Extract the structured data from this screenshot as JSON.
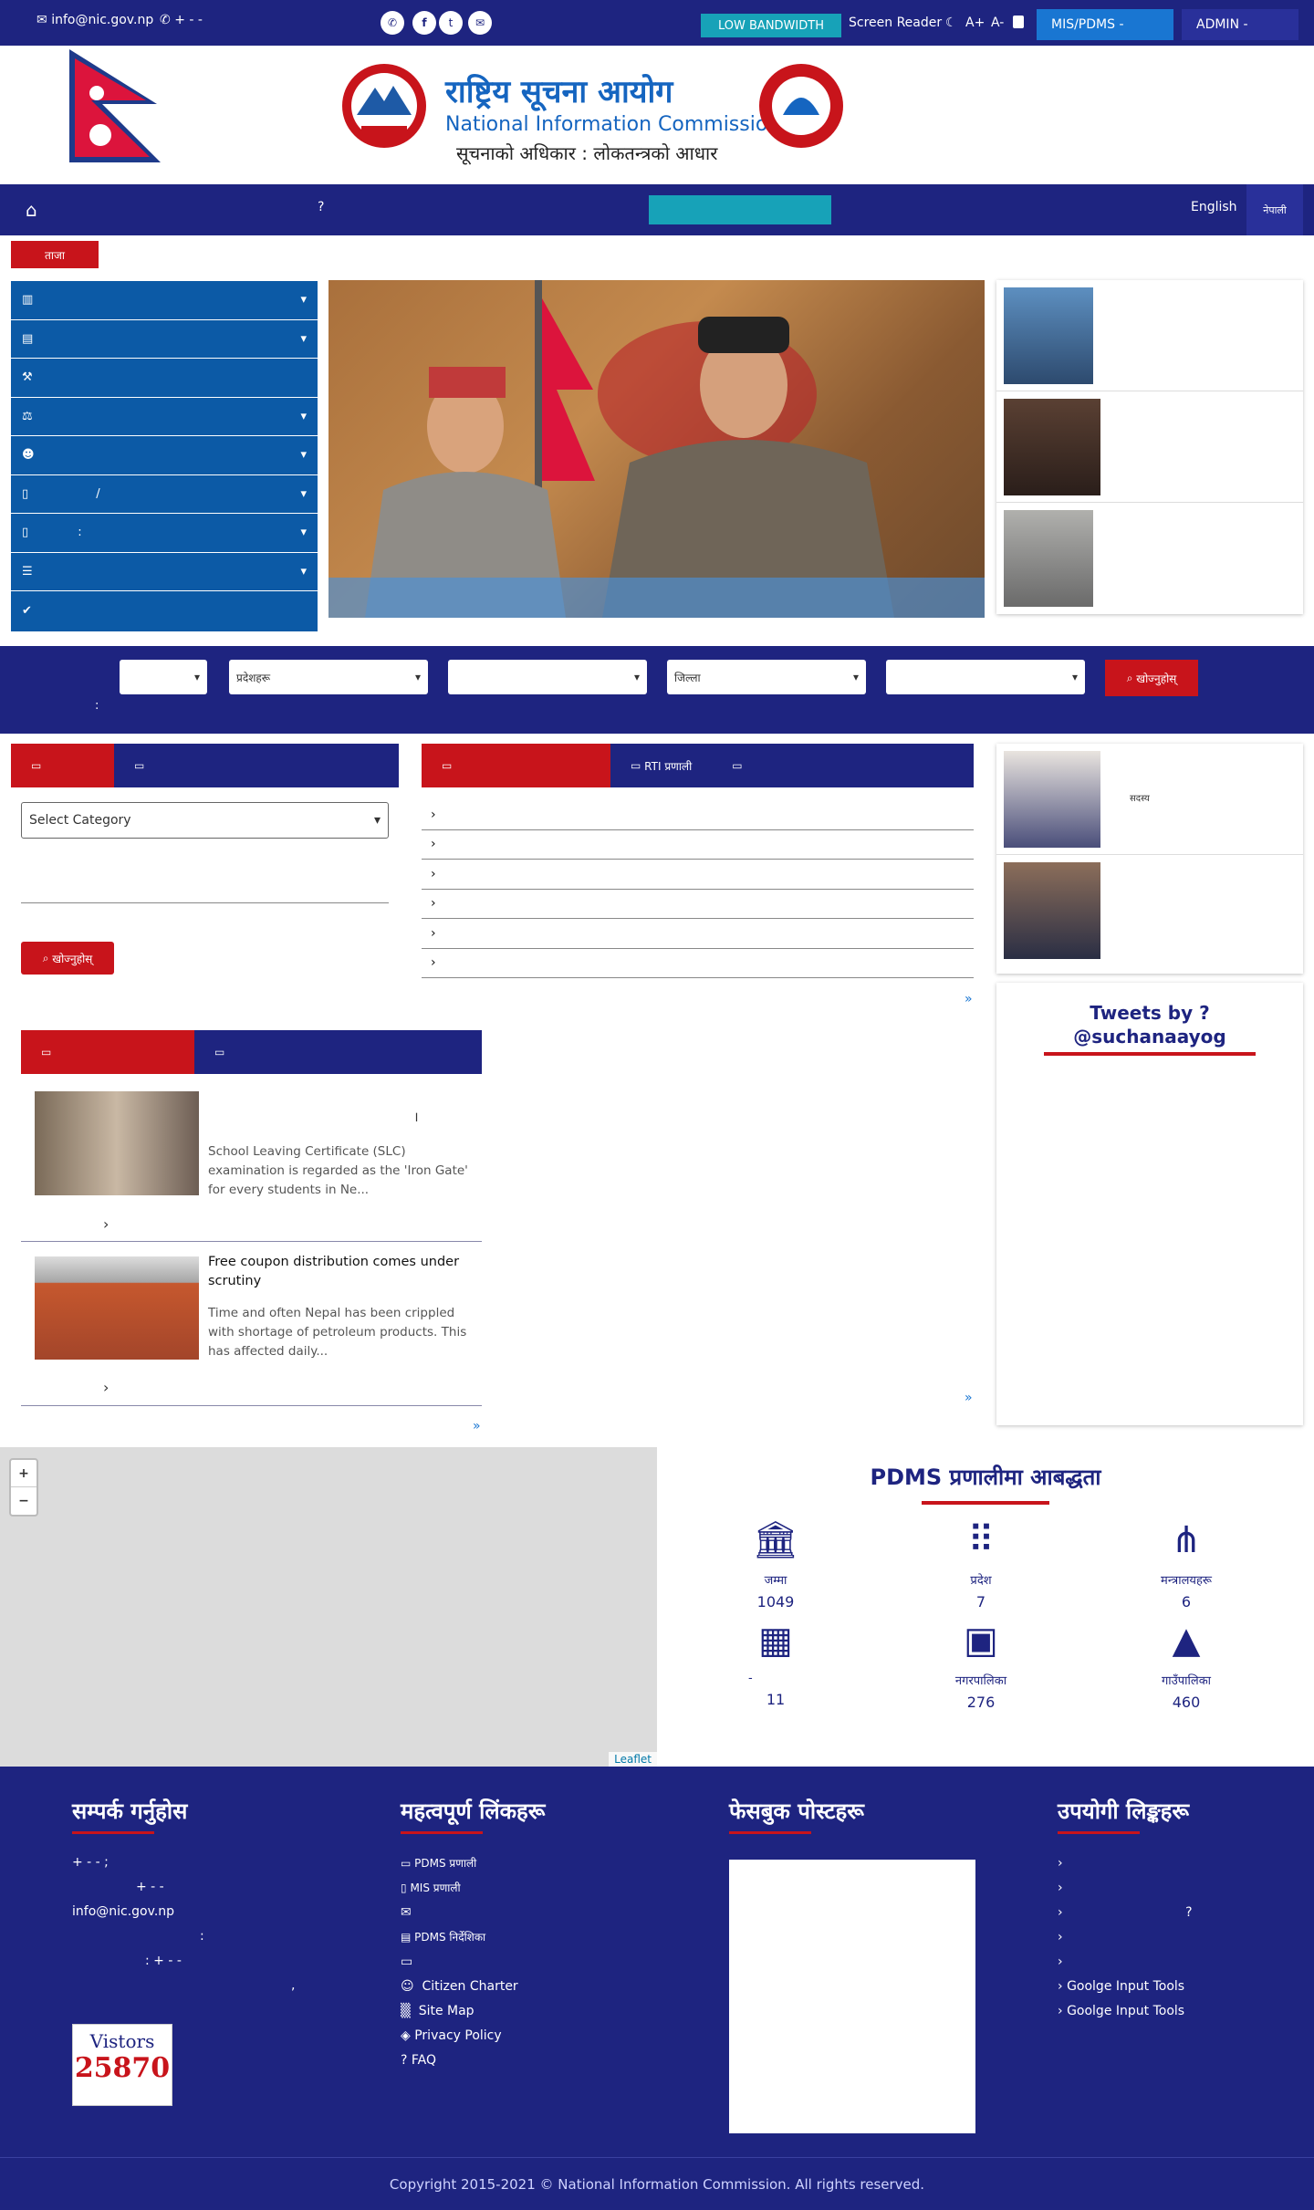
{
  "topbar": {
    "email": "info@nic.gov.np",
    "phone": "+ - -",
    "low_bandwidth": "LOW BANDWIDTH",
    "screen_reader": "Screen Reader",
    "font_plus": "A+",
    "font_minus": "A-",
    "mis_pdms": "MIS/PDMS -",
    "admin": "ADMIN -"
  },
  "header": {
    "title_np": "राष्ट्रिय सूचना आयोग",
    "title_en": "National Information Commission",
    "slogan": "सूचनाको अधिकार : लोकतन्त्रको आधार"
  },
  "nav": {
    "question_mark": "?",
    "english": "English",
    "nepali": "नेपाली"
  },
  "news_badge": "ताजा",
  "side_menu": {
    "items": [
      {
        "icon": "columns-icon",
        "label": "",
        "caret": true
      },
      {
        "icon": "book-icon",
        "label": "",
        "caret": true
      },
      {
        "icon": "gavel-icon",
        "label": "",
        "caret": false
      },
      {
        "icon": "balance-scale-icon",
        "label": "",
        "caret": true
      },
      {
        "icon": "users-icon",
        "label": "",
        "caret": true
      },
      {
        "icon": "document-icon",
        "label": "/",
        "caret": true
      },
      {
        "icon": "document-icon",
        "label": ":",
        "caret": true
      },
      {
        "icon": "list-icon",
        "label": "",
        "caret": true
      },
      {
        "icon": "check-icon",
        "label": "",
        "caret": false
      }
    ]
  },
  "filter": {
    "selects": [
      "",
      "प्रदेशहरू",
      "",
      "जिल्ला",
      ""
    ],
    "search_button": "खोज्नुहोस्",
    "colon": ":"
  },
  "left_panel": {
    "select_placeholder": "Select Category",
    "search_button": "खोज्नुहोस्"
  },
  "middle_tabs": {
    "tab2": "RTI प्रणाली"
  },
  "right_person": {
    "label": "सदस्य"
  },
  "tweets": {
    "title": "Tweets by ? @suchanaayog"
  },
  "articles": [
    {
      "title": "।",
      "excerpt": "School Leaving Certificate (SLC) examination is regarded as the 'Iron Gate' for every students in Ne..."
    },
    {
      "title": "Free coupon distribution comes under scrutiny",
      "excerpt": "Time and often Nepal has been crippled with shortage of petroleum products. This has affected daily..."
    }
  ],
  "more_link": "»",
  "map": {
    "zoom_in": "+",
    "zoom_out": "−",
    "attribution": "Leaflet"
  },
  "pdms": {
    "title": "PDMS प्रणालीमा आबद्धता",
    "stats": [
      {
        "icon": "institution-icon",
        "label": "जम्मा",
        "value": "1049"
      },
      {
        "icon": "dialpad-icon",
        "label": "प्रदेश",
        "value": "7"
      },
      {
        "icon": "hierarchy-icon",
        "label": "मन्त्रालयहरू",
        "value": "6"
      },
      {
        "icon": "building-icon",
        "label": "-",
        "value": "11"
      },
      {
        "icon": "image-icon",
        "label": "नगरपालिका",
        "value": "276"
      },
      {
        "icon": "mountain-icon",
        "label": "गाउँपालिका",
        "value": "460"
      }
    ]
  },
  "footer": {
    "contact_title": "सम्पर्क गर्नुहोस",
    "contact_lines": [
      "+ - - ;",
      "+ - -",
      "info@nic.gov.np",
      ":",
      ": + - -",
      ","
    ],
    "links_title": "महत्वपूर्ण लिंकहरू",
    "links": [
      "PDMS प्रणाली",
      "MIS प्रणाली",
      "",
      "PDMS निर्देशिका",
      "",
      "Citizen Charter",
      "Site Map",
      "Privacy Policy",
      "FAQ"
    ],
    "fb_title": "फेसबुक पोस्टहरू",
    "useful_title": "उपयोगी लिङ्कहरू",
    "useful_links": [
      "",
      "",
      "?",
      "",
      "",
      "Goolge Input Tools"
    ],
    "visitors_label": "Vistors",
    "visitors_count": "25870",
    "copyright": "Copyright 2015-2021 © National Information Commission. All rights reserved."
  },
  "colors": {
    "navy": "#1e2480",
    "red": "#c8141b",
    "blue": "#0c5aa6",
    "teal": "#17a2b8"
  }
}
